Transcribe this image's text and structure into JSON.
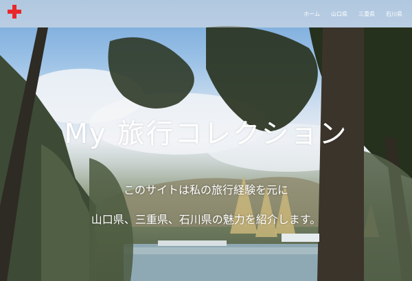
{
  "header": {
    "logo_icon": "red-plus-icon",
    "logo_color": "#e8282b",
    "nav": [
      {
        "label": "ホーム"
      },
      {
        "label": "山口県"
      },
      {
        "label": "三重県"
      },
      {
        "label": "石川県"
      }
    ]
  },
  "hero": {
    "title": "My 旅行コレクション",
    "lead_line1": "このサイトは私の旅行経験を元に",
    "lead_line2": "山口県、三重県、石川県の魅力を紹介します。"
  }
}
